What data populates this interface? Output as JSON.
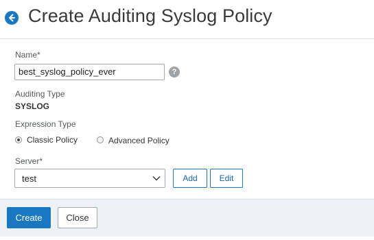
{
  "header": {
    "title": "Create Auditing Syslog Policy",
    "back_icon": "arrow-left-circle-icon"
  },
  "form": {
    "name": {
      "label": "Name*",
      "value": "best_syslog_policy_ever",
      "help_glyph": "?"
    },
    "auditing_type": {
      "label": "Auditing Type",
      "value": "SYSLOG"
    },
    "expression_type": {
      "label": "Expression Type",
      "options": [
        {
          "label": "Classic Policy",
          "selected": true
        },
        {
          "label": "Advanced Policy",
          "selected": false
        }
      ]
    },
    "server": {
      "label": "Server*",
      "selected": "test",
      "add_label": "Add",
      "edit_label": "Edit"
    }
  },
  "footer": {
    "create_label": "Create",
    "close_label": "Close"
  },
  "colors": {
    "accent": "#1a78c2",
    "footer_bg": "#eef2f6"
  }
}
